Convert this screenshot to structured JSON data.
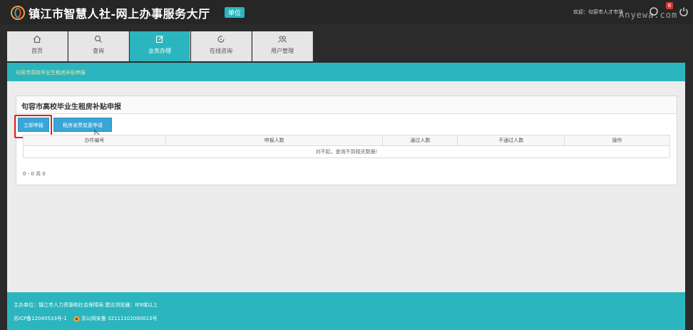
{
  "header": {
    "title": "镇江市智慧人社-网上办事服务大厅",
    "badge": "单位",
    "welcome": "欢迎：句容市人才市场",
    "notification_count": "8",
    "watermark": "Anyewa.com"
  },
  "nav": {
    "tabs": [
      {
        "label": "首页",
        "icon": "home-icon",
        "active": false
      },
      {
        "label": "查询",
        "icon": "search-icon",
        "active": false
      },
      {
        "label": "业务办理",
        "icon": "edit-icon",
        "active": true
      },
      {
        "label": "在线咨询",
        "icon": "chat-icon",
        "active": false
      },
      {
        "label": "用户管理",
        "icon": "users-icon",
        "active": false
      }
    ]
  },
  "breadcrumb": "句容市高校毕业生租房补贴申报",
  "panel": {
    "title": "句容市高校毕业生租房补贴申报",
    "buttons": {
      "apply_now": "立即申报",
      "change_apply": "租房发票变更申请"
    },
    "table": {
      "columns": [
        "办件编号",
        "申报人数",
        "通过人数",
        "不通过人数",
        "操作"
      ],
      "empty_message": "对不起，查询不到相关数据!"
    },
    "pager": "0 - 0 共 0"
  },
  "footer": {
    "line1": "主办单位：镇江市人力资源和社会保障局    建议浏览器：IE9或以上",
    "icp": "苏ICP备12045533号-1",
    "police": "苏公网安备 32111102000013号"
  },
  "colors": {
    "accent": "#2bb5be",
    "button": "#3aa5d6",
    "highlight": "#e02020",
    "header_bg": "#262626"
  }
}
